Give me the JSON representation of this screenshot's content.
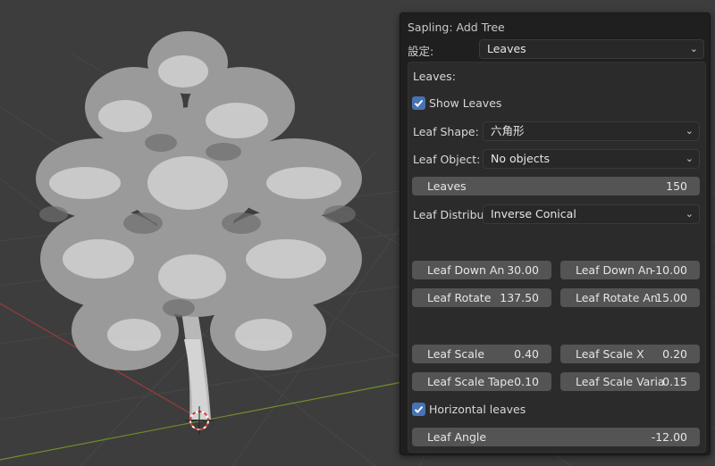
{
  "panel": {
    "title": "Sapling: Add Tree",
    "preset_label": "設定:",
    "preset_value": "Leaves"
  },
  "leaves": {
    "section_title": "Leaves:",
    "show_leaves": {
      "label": "Show Leaves",
      "checked": true
    },
    "leaf_shape": {
      "label": "Leaf Shape:",
      "value": "六角形"
    },
    "leaf_object": {
      "label": "Leaf Object:",
      "value": "No objects"
    },
    "leaves_count": {
      "label": "Leaves",
      "value": "150"
    },
    "leaf_distribution": {
      "label": "Leaf Distribu...",
      "value": "Inverse Conical"
    },
    "fields": {
      "leaf_down_angle": {
        "label": "Leaf Down An",
        "value": "30.00"
      },
      "leaf_down_angle_var": {
        "label": "Leaf Down An",
        "value": "-10.00"
      },
      "leaf_rotate": {
        "label": "Leaf Rotate",
        "value": "137.50"
      },
      "leaf_rotate_var": {
        "label": "Leaf Rotate An",
        "value": "15.00"
      },
      "leaf_scale": {
        "label": "Leaf Scale",
        "value": "0.40"
      },
      "leaf_scale_x": {
        "label": "Leaf Scale X",
        "value": "0.20"
      },
      "leaf_scale_taper": {
        "label": "Leaf Scale Tape",
        "value": "0.10"
      },
      "leaf_scale_var": {
        "label": "Leaf Scale Varia",
        "value": "0.15"
      }
    },
    "horizontal_leaves": {
      "label": "Horizontal leaves",
      "checked": true
    },
    "leaf_angle": {
      "label": "Leaf Angle",
      "value": "-12.00"
    }
  },
  "colors": {
    "viewport_bg": "#3d3d3d",
    "panel_bg": "#1f1f1f",
    "field_bg": "#545454",
    "checkbox_blue": "#4772b3",
    "axis_red": "#9a3b3b",
    "axis_green": "#6f8e2c"
  },
  "icons": {
    "dropdown": "chevron-down-icon",
    "check": "checkmark-icon",
    "cursor": "3d-cursor-icon"
  }
}
